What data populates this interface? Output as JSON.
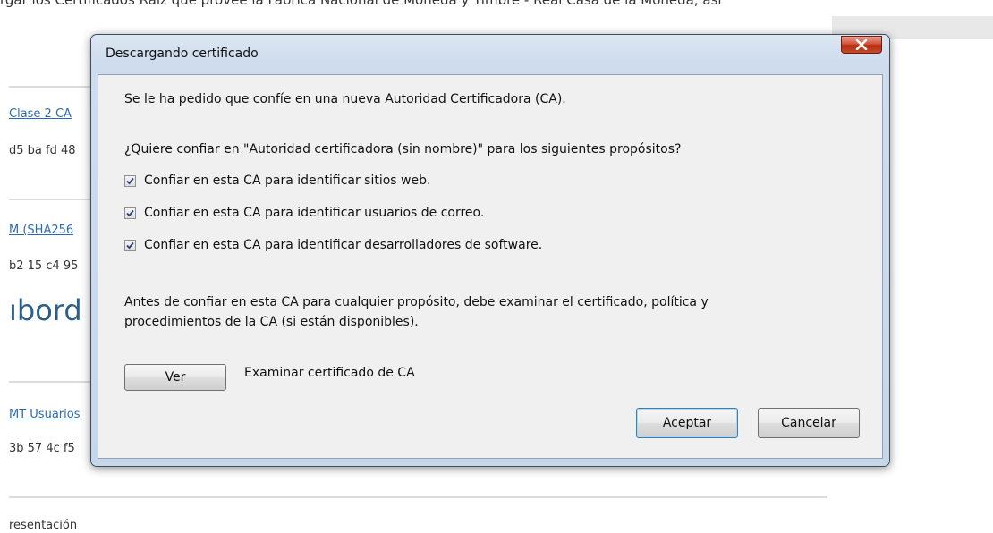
{
  "background_page": {
    "top_text": "rgar los Certificados Raíz que provee la Fábrica Nacional de Moneda y Timbre - Real Casa de la Moneda, así",
    "link_1": "Clase 2 CA",
    "hash_1": "d5 ba fd 48",
    "link_2": "M (SHA256",
    "hash_2": "b2 15 c4 95",
    "heading": "ıbord",
    "link_3": "MT Usuarios",
    "hash_3": "3b 57 4c f5",
    "footer": "resentación"
  },
  "dialog": {
    "title": "Descargando certificado",
    "close_icon": "close-x-icon",
    "intro": "Se le ha pedido que confíe en una nueva Autoridad Certificadora (CA).",
    "question": "¿Quiere confiar en \"Autoridad certificadora (sin nombre)\" para los siguientes propósitos?",
    "options": [
      {
        "label": "Confiar en esta CA para identificar sitios web.",
        "checked": true
      },
      {
        "label": "Confiar en esta CA para identificar usuarios de correo.",
        "checked": true
      },
      {
        "label": "Confiar en esta CA para identificar desarrolladores de software.",
        "checked": true
      }
    ],
    "warning_line_1": "Antes de confiar en esta CA para cualquier propósito, debe examinar el certificado, política y",
    "warning_line_2": "procedimientos de la CA (si están disponibles).",
    "view_button": "Ver",
    "view_description": "Examinar certificado de CA",
    "accept_button": "Aceptar",
    "cancel_button": "Cancelar"
  },
  "colors": {
    "link": "#2d6bb1",
    "heading": "#2c5f8a",
    "close_button": "#c64a2c",
    "dialog_frame": "#cfdced"
  }
}
